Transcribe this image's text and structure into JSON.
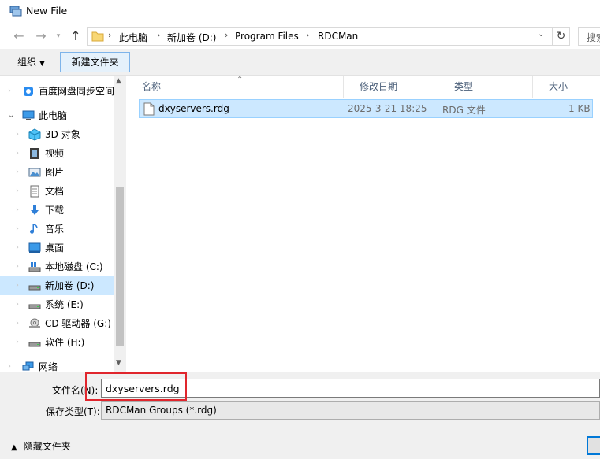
{
  "window": {
    "title": "New File"
  },
  "nav": {
    "breadcrumbs": [
      "此电脑",
      "新加卷 (D:)",
      "Program Files",
      "RDCMan"
    ],
    "search_placeholder": "搜索"
  },
  "toolbar": {
    "organize_label": "组织",
    "new_folder_label": "新建文件夹"
  },
  "sidebar": {
    "items": [
      {
        "label": "百度网盘同步空间",
        "icon": "baidu-cloud-icon"
      },
      {
        "label": "此电脑",
        "icon": "computer-icon"
      },
      {
        "label": "3D 对象",
        "icon": "3d-objects-icon"
      },
      {
        "label": "视频",
        "icon": "videos-icon"
      },
      {
        "label": "图片",
        "icon": "pictures-icon"
      },
      {
        "label": "文档",
        "icon": "documents-icon"
      },
      {
        "label": "下载",
        "icon": "downloads-icon"
      },
      {
        "label": "音乐",
        "icon": "music-icon"
      },
      {
        "label": "桌面",
        "icon": "desktop-icon"
      },
      {
        "label": "本地磁盘 (C:)",
        "icon": "windows-drive-icon"
      },
      {
        "label": "新加卷 (D:)",
        "icon": "drive-icon",
        "selected": true
      },
      {
        "label": "系统 (E:)",
        "icon": "drive-icon"
      },
      {
        "label": "CD 驱动器 (G:)",
        "icon": "cd-drive-icon"
      },
      {
        "label": "软件 (H:)",
        "icon": "drive-icon"
      },
      {
        "label": "网络",
        "icon": "network-icon"
      }
    ]
  },
  "filelist": {
    "columns": [
      "名称",
      "修改日期",
      "类型",
      "大小"
    ],
    "rows": [
      {
        "name": "dxyservers.rdg",
        "modified": "2025-3-21 18:25",
        "type": "RDG 文件",
        "size": "1 KB"
      }
    ]
  },
  "form": {
    "filename_label": "文件名(N):",
    "filename_value": "dxyservers.rdg",
    "filetype_label": "保存类型(T):",
    "filetype_value": "RDCMan Groups (*.rdg)"
  },
  "footer": {
    "hide_folders_label": "隐藏文件夹"
  },
  "colors": {
    "selection": "#cce8ff",
    "highlight_border": "#e0262d",
    "accent": "#0078d7"
  }
}
